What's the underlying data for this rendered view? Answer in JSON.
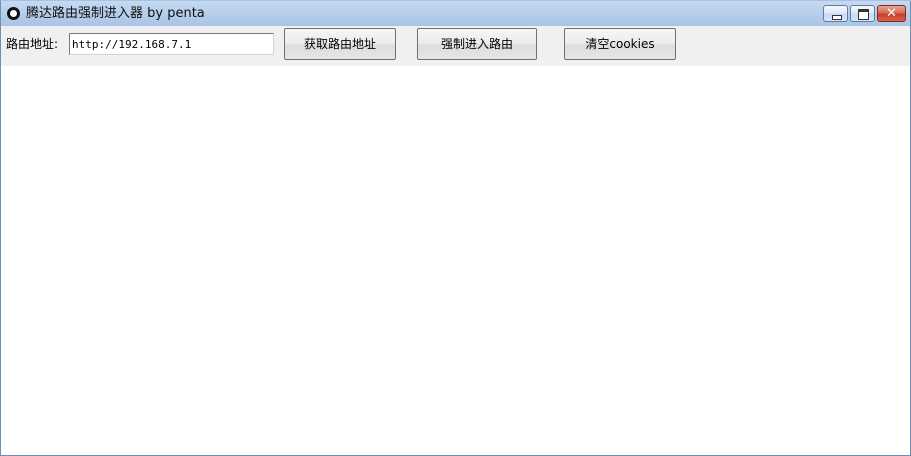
{
  "window": {
    "title": "腾达路由强制进入器 by penta",
    "icon": "app-circle-icon",
    "controls": {
      "minimize": "minimize-icon",
      "maximize": "maximize-icon",
      "close_glyph": "✕"
    }
  },
  "toolbar": {
    "address_label": "路由地址:",
    "address_value": "http://192.168.7.1",
    "get_address_label": "获取路由地址",
    "force_enter_label": "强制进入路由",
    "clear_cookies_label": "清空cookies"
  },
  "colors": {
    "titlebar": "#b7cfec",
    "toolbar_bg": "#f0f0f0",
    "content_bg": "#ffffff",
    "close_button": "#c4402a"
  }
}
